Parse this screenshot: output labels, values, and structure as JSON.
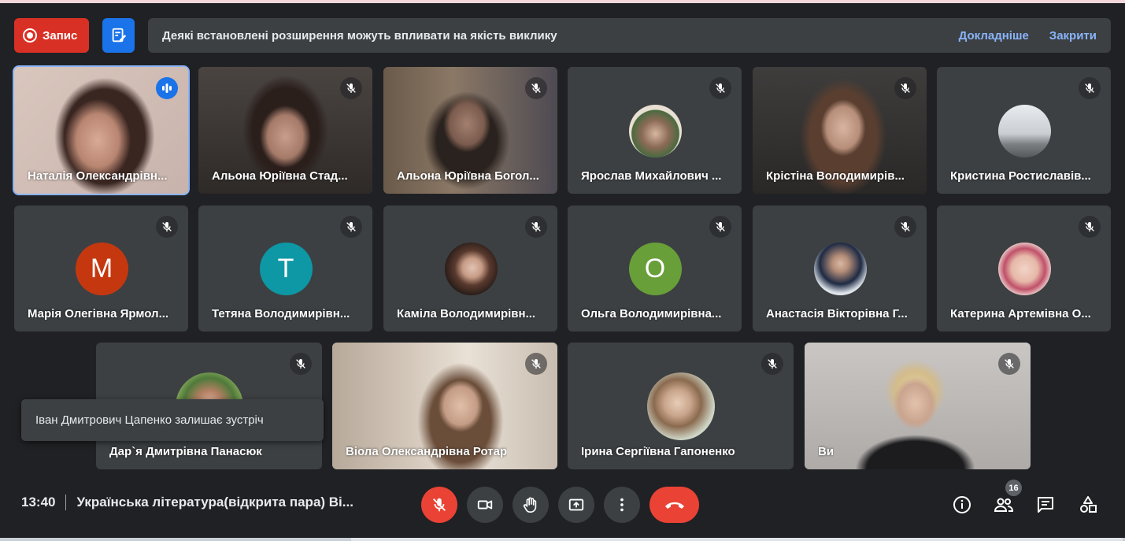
{
  "header": {
    "record_label": "Запис",
    "banner_message": "Деякі встановлені розширення можуть впливати на якість виклику",
    "learn_more": "Докладніше",
    "dismiss": "Закрити"
  },
  "participants": [
    {
      "name": "Наталія Олександрівн...",
      "speaking": true
    },
    {
      "name": "Альона Юріївна Стад...",
      "muted": true
    },
    {
      "name": "Альона Юріївна Богол...",
      "muted": true
    },
    {
      "name": "Ярослав Михайлович ...",
      "muted": true,
      "avatar": "photo"
    },
    {
      "name": "Крістіна Володимирів...",
      "muted": true
    },
    {
      "name": "Кристина Ростиславів...",
      "muted": true,
      "avatar": "photo"
    },
    {
      "name": "Марія Олегівна Ярмол...",
      "muted": true,
      "initial": "М",
      "color": "#c5380f"
    },
    {
      "name": "Тетяна Володимирівн...",
      "muted": true,
      "initial": "Т",
      "color": "#0e97a4"
    },
    {
      "name": "Каміла Володимирівн...",
      "muted": true,
      "avatar": "photo"
    },
    {
      "name": "Ольга Володимирівна...",
      "muted": true,
      "initial": "О",
      "color": "#689f38"
    },
    {
      "name": "Анастасія Вікторівна Г...",
      "muted": true,
      "avatar": "photo"
    },
    {
      "name": "Катерина Артемівна О...",
      "muted": true,
      "avatar": "photo"
    },
    {
      "name": "Дар`я Дмитрівна Панасюк",
      "muted": true,
      "avatar": "photo"
    },
    {
      "name": "Віола Олександрівна Ротар",
      "muted": true
    },
    {
      "name": "Ірина Сергіївна Гапоненко",
      "muted": true,
      "avatar": "photo"
    },
    {
      "name": "Ви",
      "muted": true
    }
  ],
  "toast": {
    "message": "Іван Дмитрович Цапенко залишає зустріч"
  },
  "footer": {
    "time": "13:40",
    "meeting_title": "Українська література(відкрита пара) Ві...",
    "participant_count": "16"
  },
  "colors": {
    "background": "#202124",
    "tile": "#3c4043",
    "accent_blue": "#1a73e8",
    "danger_red": "#ea4335",
    "link_blue": "#8ab4f8"
  }
}
